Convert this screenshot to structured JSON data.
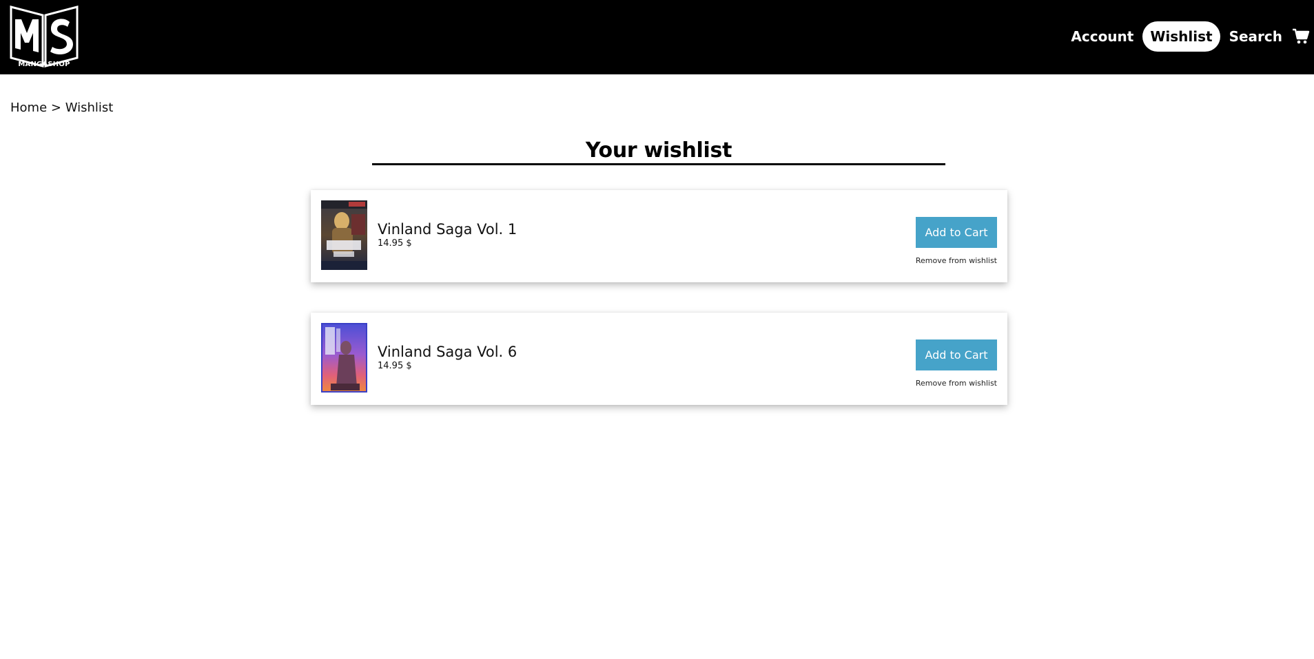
{
  "header": {
    "logo": {
      "letters": "MS",
      "name": "MANGASHOP"
    },
    "nav": [
      {
        "label": "Account",
        "active": false
      },
      {
        "label": "Wishlist",
        "active": true
      },
      {
        "label": "Search",
        "active": false
      }
    ],
    "cart_icon": "shopping-cart-icon"
  },
  "breadcrumb": {
    "home": "Home",
    "separator": ">",
    "current": "Wishlist"
  },
  "page": {
    "title": "Your wishlist"
  },
  "wishlist": {
    "items": [
      {
        "title": "Vinland Saga Vol. 1",
        "price": "14.95 $",
        "add_label": "Add to Cart",
        "remove_label": "Remove from wishlist"
      },
      {
        "title": "Vinland Saga Vol. 6",
        "price": "14.95 $",
        "add_label": "Add to Cart",
        "remove_label": "Remove from wishlist"
      }
    ]
  },
  "colors": {
    "header_bg": "#000000",
    "accent_button": "#46a3c9",
    "active_pill": "#ffffff"
  }
}
